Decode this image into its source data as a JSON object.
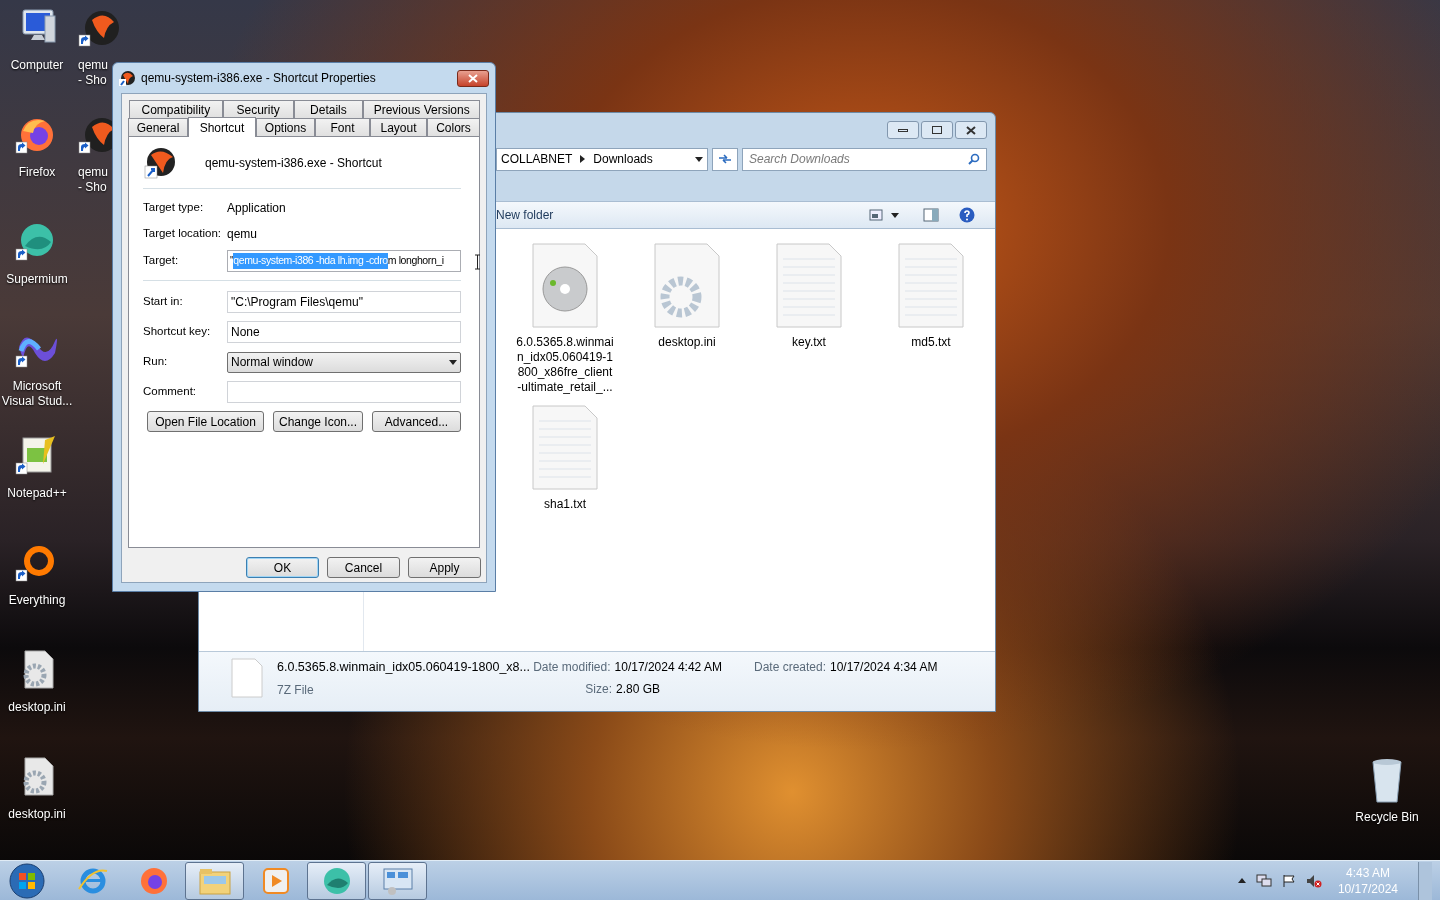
{
  "desktop": {
    "columns": [
      [
        {
          "label": "Computer",
          "kind": "computer",
          "shortcut": false
        },
        {
          "label": "Firefox",
          "kind": "firefox",
          "shortcut": true
        },
        {
          "label": "Supermium",
          "kind": "supermium",
          "shortcut": true
        },
        {
          "label": "Microsoft Visual Stud...",
          "kind": "studio",
          "shortcut": true
        },
        {
          "label": "Notepad++",
          "kind": "notepad",
          "shortcut": true
        },
        {
          "label": "Everything",
          "kind": "everything",
          "shortcut": true
        },
        {
          "label": "desktop.ini",
          "kind": "settings_file",
          "shortcut": false
        },
        {
          "label": "desktop.ini",
          "kind": "settings_file",
          "shortcut": false
        }
      ],
      [
        {
          "label": "qemu - Sho",
          "kind": "qemu",
          "shortcut": true
        },
        {
          "label": "qemu - Sho",
          "kind": "qemu",
          "shortcut": true
        }
      ]
    ],
    "recycle_bin": {
      "label": "Recycle Bin"
    }
  },
  "explorer": {
    "breadcrumb": [
      "COLLABNET",
      "Downloads"
    ],
    "search": {
      "placeholder": "Search Downloads"
    },
    "toolbar": {
      "new_folder": "New folder"
    },
    "files": [
      {
        "name": "6.0.5365.8.winmain_idx05.060419-1800_x86fre_client-ultimate_retail_...",
        "kind": "disc"
      },
      {
        "name": "desktop.ini",
        "kind": "settings"
      },
      {
        "name": "key.txt",
        "kind": "text"
      },
      {
        "name": "md5.txt",
        "kind": "text"
      },
      {
        "name": "sha1.txt",
        "kind": "text"
      }
    ],
    "details": {
      "name": "6.0.5365.8.winmain_idx05.060419-1800_x8...",
      "type": "7Z File",
      "fields": [
        {
          "label": "Date modified:",
          "value": "10/17/2024 4:42 AM"
        },
        {
          "label": "Size:",
          "value": "2.80 GB"
        },
        {
          "label": "Date created:",
          "value": "10/17/2024 4:34 AM"
        }
      ]
    }
  },
  "properties_dialog": {
    "title": "qemu-system-i386.exe - Shortcut Properties",
    "tab_rows": [
      [
        {
          "label": "Compatibility",
          "selected": false
        },
        {
          "label": "Security",
          "selected": false
        },
        {
          "label": "Details",
          "selected": false
        },
        {
          "label": "Previous Versions",
          "selected": false
        }
      ],
      [
        {
          "label": "General",
          "selected": false
        },
        {
          "label": "Shortcut",
          "selected": true
        },
        {
          "label": "Options",
          "selected": false
        },
        {
          "label": "Font",
          "selected": false
        },
        {
          "label": "Layout",
          "selected": false
        },
        {
          "label": "Colors",
          "selected": false
        }
      ]
    ],
    "header": "qemu-system-i386.exe - Shortcut",
    "sections": [
      [
        {
          "kind": "info",
          "label": "Target type:",
          "value": "Application"
        },
        {
          "kind": "info",
          "label": "Target location:",
          "value": "qemu"
        },
        {
          "kind": "target",
          "label": "Target:",
          "before": "\"",
          "selected_text": "qemu-system-i386 -hda lh.img -cdro",
          "after": "m longhorn_i"
        }
      ],
      [
        {
          "kind": "field",
          "label": "Start in:",
          "value": "\"C:\\Program Files\\qemu\""
        },
        {
          "kind": "field",
          "label": "Shortcut key:",
          "value": "None"
        },
        {
          "kind": "dropdown",
          "label": "Run:",
          "value": "Normal window"
        },
        {
          "kind": "field",
          "label": "Comment:"
        }
      ]
    ],
    "action_buttons": [
      "Open File Location",
      "Change Icon...",
      "Advanced..."
    ],
    "footer_buttons": [
      {
        "label": "OK",
        "default": true
      },
      {
        "label": "Cancel",
        "default": false
      },
      {
        "label": "Apply",
        "default": false
      }
    ]
  },
  "taskbar": {
    "apps": [
      {
        "kind": "ie",
        "running": false
      },
      {
        "kind": "firefox",
        "running": false
      },
      {
        "kind": "explorer",
        "running": true
      },
      {
        "kind": "media",
        "running": false
      },
      {
        "kind": "supermium",
        "running": true
      },
      {
        "kind": "control",
        "running": true
      }
    ],
    "clock": {
      "time": "4:43 AM",
      "date": "10/17/2024"
    }
  }
}
